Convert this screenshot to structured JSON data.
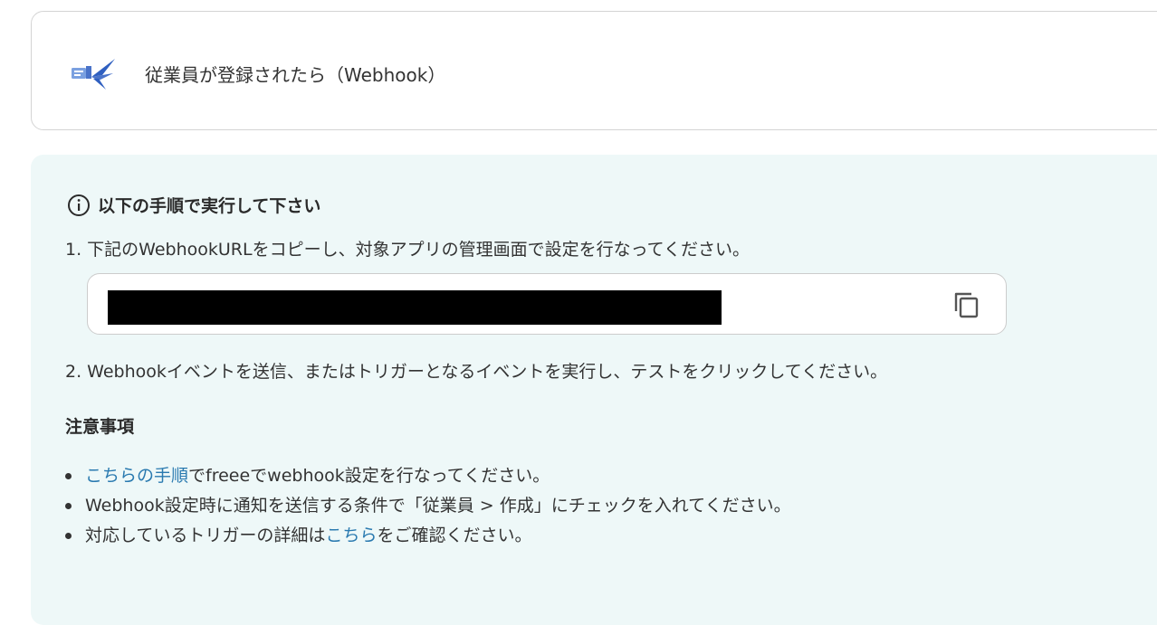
{
  "trigger": {
    "icon": "freee-hr-app-icon",
    "title": "従業員が登録されたら（Webhook）"
  },
  "instructions": {
    "icon": "info-icon",
    "heading": "以下の手順で実行して下さい",
    "step1": "1. 下記のWebhookURLをコピーし、対象アプリの管理画面で設定を行なってください。",
    "webhook_url": "",
    "copy_icon": "copy-icon",
    "step2": "2. Webhookイベントを送信、またはトリガーとなるイベントを実行し、テストをクリックしてください。"
  },
  "notes": {
    "heading": "注意事項",
    "items": [
      {
        "link": "こちらの手順",
        "text": "でfreeeでwebhook設定を行なってください。"
      },
      {
        "text": "Webhook設定時に通知を送信する条件で「従業員 > 作成」にチェックを入れてください。"
      },
      {
        "prefix": "対応しているトリガーの詳細は",
        "link": "こちら",
        "suffix": "をご確認ください。"
      }
    ]
  },
  "colors": {
    "panel_background": "#eef8f8",
    "link": "#2a7ab0",
    "icon_blue": "#4a73c9"
  }
}
